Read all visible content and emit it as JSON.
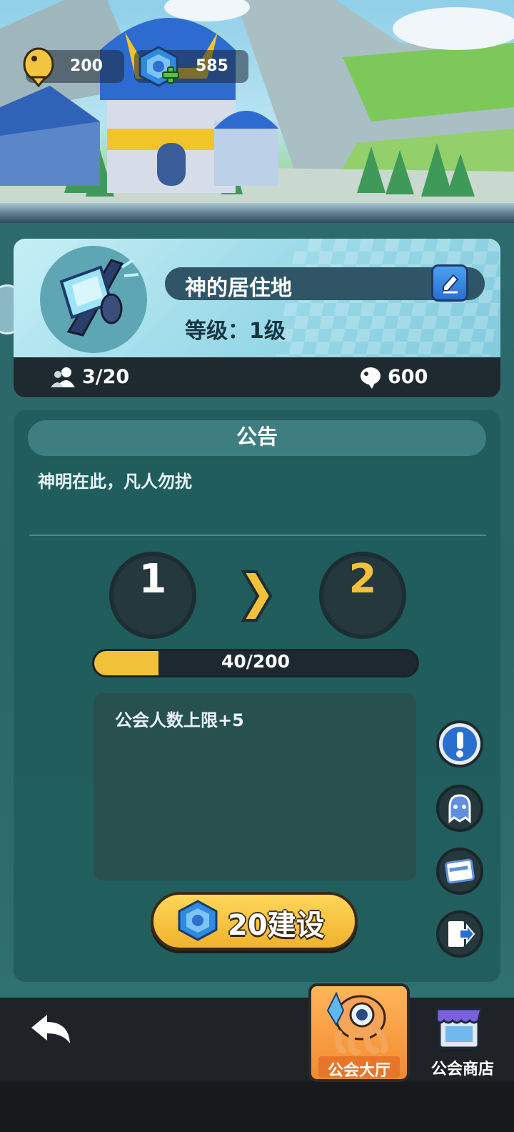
{
  "currency": {
    "fish": {
      "icon": "fish-coin-icon",
      "value": "200"
    },
    "gem": {
      "icon": "blue-gem-icon",
      "add_icon": "plus-icon",
      "value": "585"
    }
  },
  "guild": {
    "emblem_icon": "ice-hammer-emblem-icon",
    "name": "神的居住地",
    "edit_icon": "edit-pencil-icon",
    "level_text": "等级：1级",
    "members": {
      "icon": "members-icon",
      "value": "3/20"
    },
    "funds": {
      "icon": "fish-funds-icon",
      "value": "600"
    }
  },
  "notice": {
    "title": "公告",
    "text": "神明在此，凡人勿扰"
  },
  "upgrade": {
    "current_level": "1",
    "next_level": "2",
    "arrow_icon": "chevron-right-icon",
    "progress_text": "40/200",
    "progress_fraction": 0.2,
    "reward_text": "公会人数上限+5"
  },
  "build_button": {
    "icon": "blue-gem-icon",
    "label": "20建设"
  },
  "side_buttons": [
    {
      "name": "info",
      "icon": "exclamation-icon"
    },
    {
      "name": "members",
      "icon": "ghost-icon"
    },
    {
      "name": "log",
      "icon": "card-icon"
    },
    {
      "name": "exit",
      "icon": "exit-door-icon"
    }
  ],
  "nav": {
    "back_icon": "back-arrow-icon",
    "hall": {
      "icon": "octopus-mascot-icon",
      "label": "公会大厅"
    },
    "shop": {
      "icon": "shop-icon",
      "label": "公会商店"
    }
  },
  "colors": {
    "accent_yellow": "#f2c13a",
    "panel_teal": "#2b6666",
    "active_tab_orange": "#f38a2f",
    "exclamation_blue": "#2a6fd0"
  }
}
